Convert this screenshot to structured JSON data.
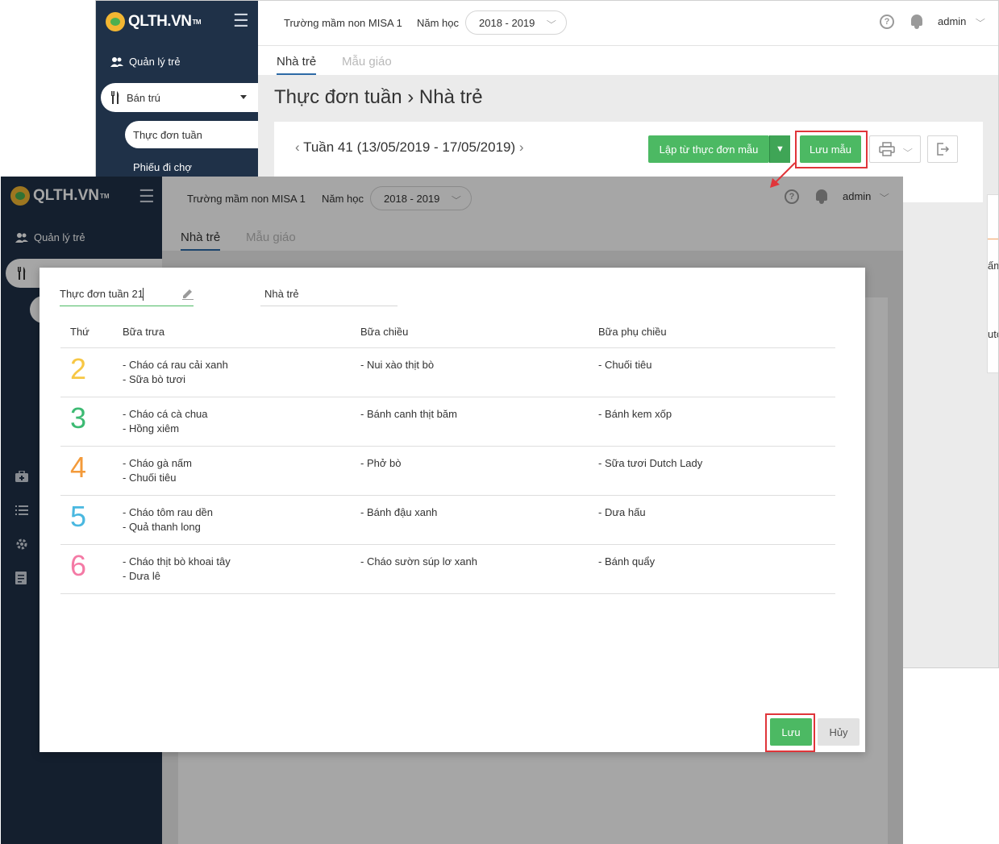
{
  "app": {
    "logo_text": "QLTH.VN",
    "logo_tm": "TM",
    "school": "Trường mầm non MISA 1",
    "year_label": "Năm học",
    "year_value": "2018 - 2019",
    "user": "admin"
  },
  "sidebar": {
    "item_manage": "Quản lý trẻ",
    "item_boarding": "Bán trú",
    "sub_weekly_menu": "Thực đơn tuần",
    "sub_market": "Phiếu đi chợ"
  },
  "tabs": {
    "nursery": "Nhà trẻ",
    "kindergarten": "Mẫu giáo"
  },
  "page": {
    "title": "Thực đơn tuần",
    "title_sep": "›",
    "title_sub": "Nhà trẻ",
    "week": "Tuần 41 (13/05/2019 - 17/05/2019)",
    "btn_create_from_template": "Lập từ thực đơn mẫu",
    "btn_save_template": "Lưu mẫu",
    "panel_text_1": "ấm;",
    "panel_text_2": "utch"
  },
  "modal": {
    "name_value": "Thực đơn tuần 21",
    "group_value": "Nhà trẻ",
    "columns": [
      "Thứ",
      "Bữa trưa",
      "Bữa chiều",
      "Bữa phụ chiều"
    ],
    "rows": [
      {
        "day": "2",
        "color": "#f7c744",
        "lunch": [
          "- Cháo cá rau cải xanh",
          "- Sữa bò tươi"
        ],
        "afternoon": "- Nui xào thịt bò",
        "snack": "- Chuối tiêu"
      },
      {
        "day": "3",
        "color": "#3dba73",
        "lunch": [
          "- Cháo cá cà chua",
          "- Hồng xiêm"
        ],
        "afternoon": "- Bánh canh thịt băm",
        "snack": "- Bánh kem xốp"
      },
      {
        "day": "4",
        "color": "#f39a3a",
        "lunch": [
          "- Cháo gà nấm",
          "- Chuối tiêu"
        ],
        "afternoon": "- Phở bò",
        "snack": "- Sữa tươi Dutch Lady"
      },
      {
        "day": "5",
        "color": "#4ab8e0",
        "lunch": [
          "- Cháo tôm rau dền",
          "- Quả thanh long"
        ],
        "afternoon": "- Bánh đậu xanh",
        "snack": "- Dưa hấu"
      },
      {
        "day": "6",
        "color": "#f47aa5",
        "lunch": [
          "- Cháo thịt bò khoai tây",
          "- Dưa lê"
        ],
        "afternoon": "- Cháo sườn súp lơ xanh",
        "snack": "- Bánh quẩy"
      }
    ],
    "btn_save": "Lưu",
    "btn_cancel": "Hủy"
  },
  "colors": {
    "sidebar": "#1f3148",
    "accent_green": "#4cb963",
    "highlight_red": "#e0353a",
    "tab_underline": "#2d6aa6"
  },
  "icons": [
    "logo-icon",
    "hamburger-icon",
    "users-icon",
    "utensils-icon",
    "help-icon",
    "bell-icon",
    "chevron-down-icon",
    "chevron-left-icon",
    "chevron-right-icon",
    "printer-icon",
    "export-icon",
    "pencil-icon",
    "medkit-icon",
    "list-icon",
    "gear-icon",
    "report-icon"
  ]
}
